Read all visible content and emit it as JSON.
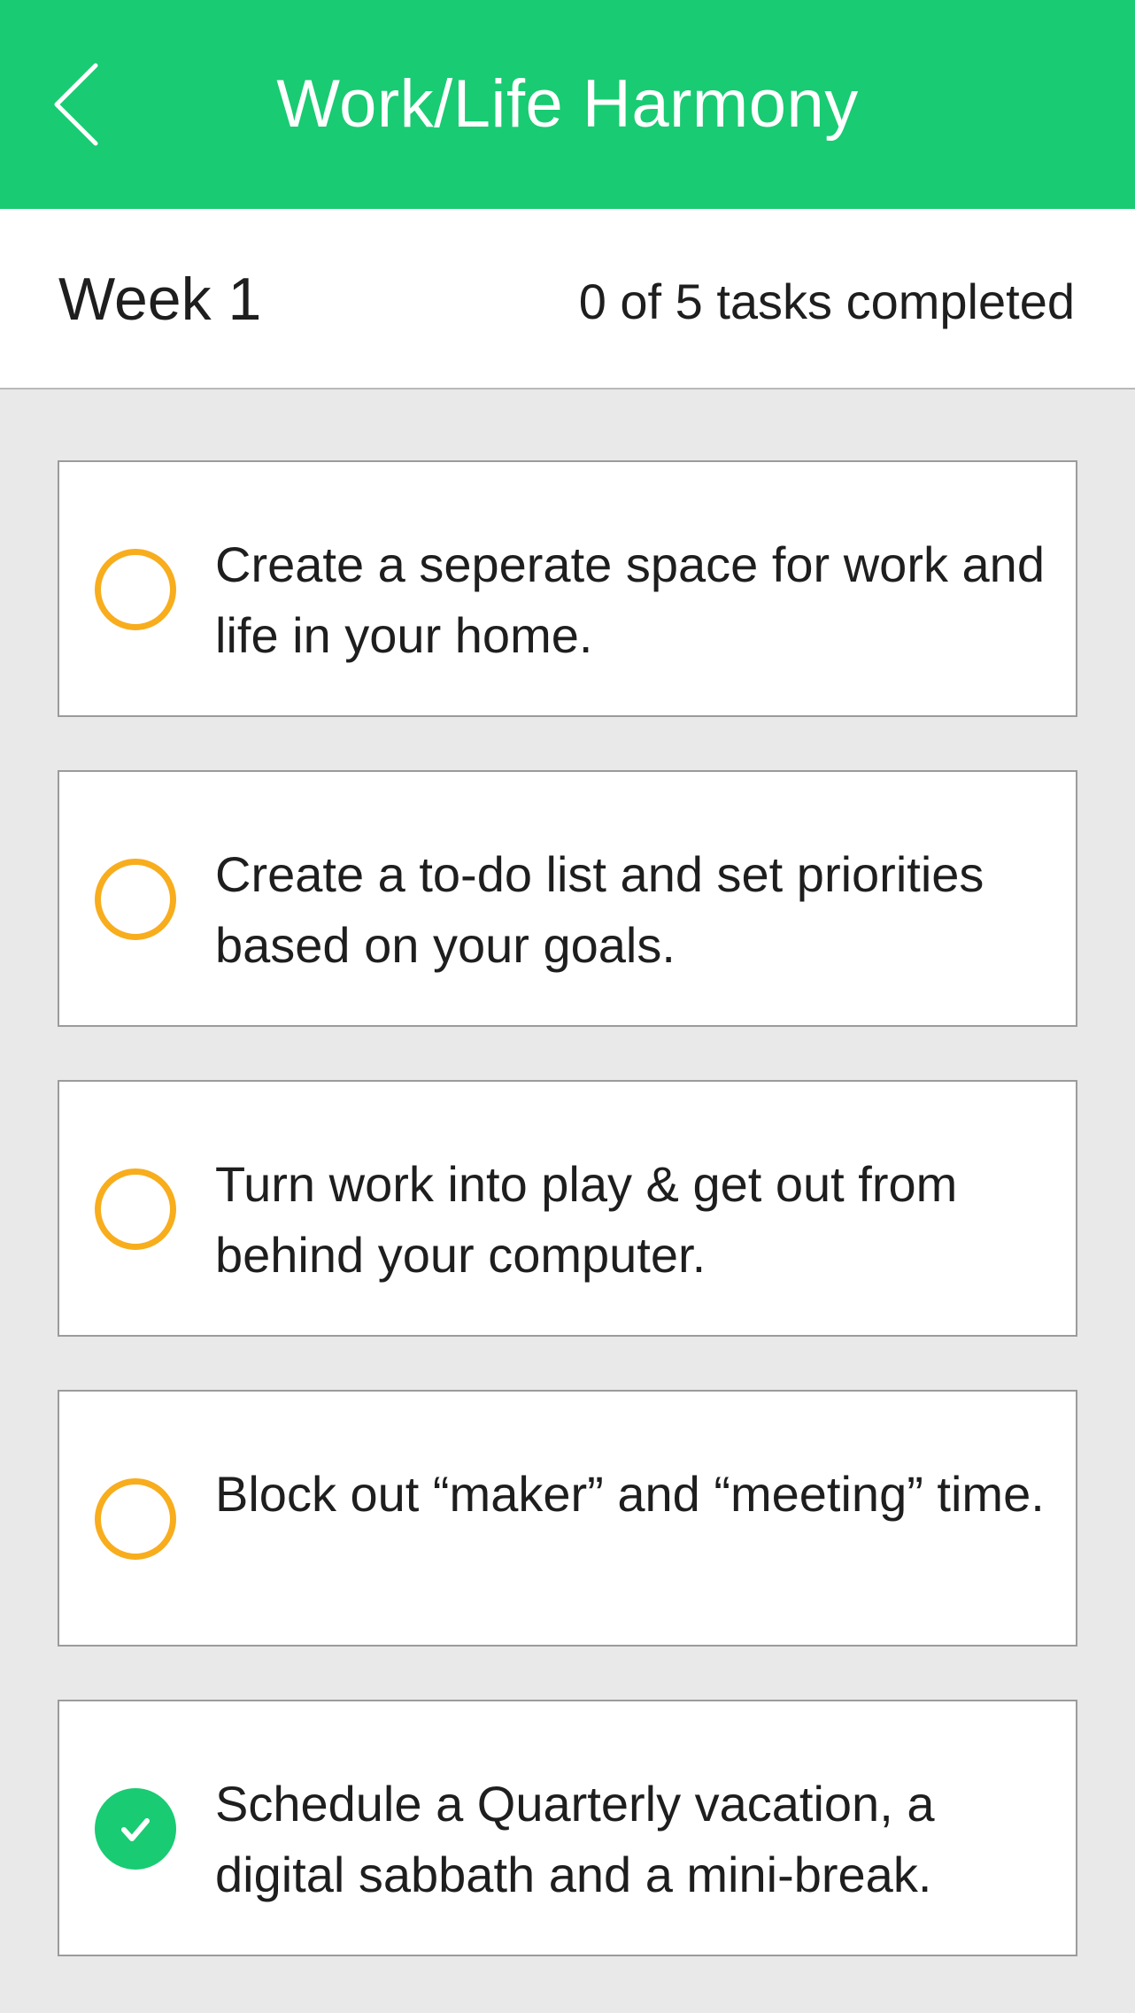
{
  "header": {
    "title": "Work/Life Harmony",
    "back_icon": "chevron-left-icon",
    "color": "#19cb72"
  },
  "week": {
    "label": "Week 1",
    "progress": "0 of 5 tasks completed"
  },
  "tasks": [
    {
      "text": "Create a seperate space for work and life in your home.",
      "completed": false
    },
    {
      "text": "Create a to-do list and set priorities based on your goals.",
      "completed": false
    },
    {
      "text": "Turn work into play & get out from behind your computer.",
      "completed": false
    },
    {
      "text": "Block out “maker” and “meeting” time.",
      "completed": false
    },
    {
      "text": "Schedule a Quarterly vacation, a digital sabbath and a mini-break.",
      "completed": true
    }
  ],
  "colors": {
    "pending_circle": "#f8ad1d",
    "completed_circle": "#19cb72"
  }
}
